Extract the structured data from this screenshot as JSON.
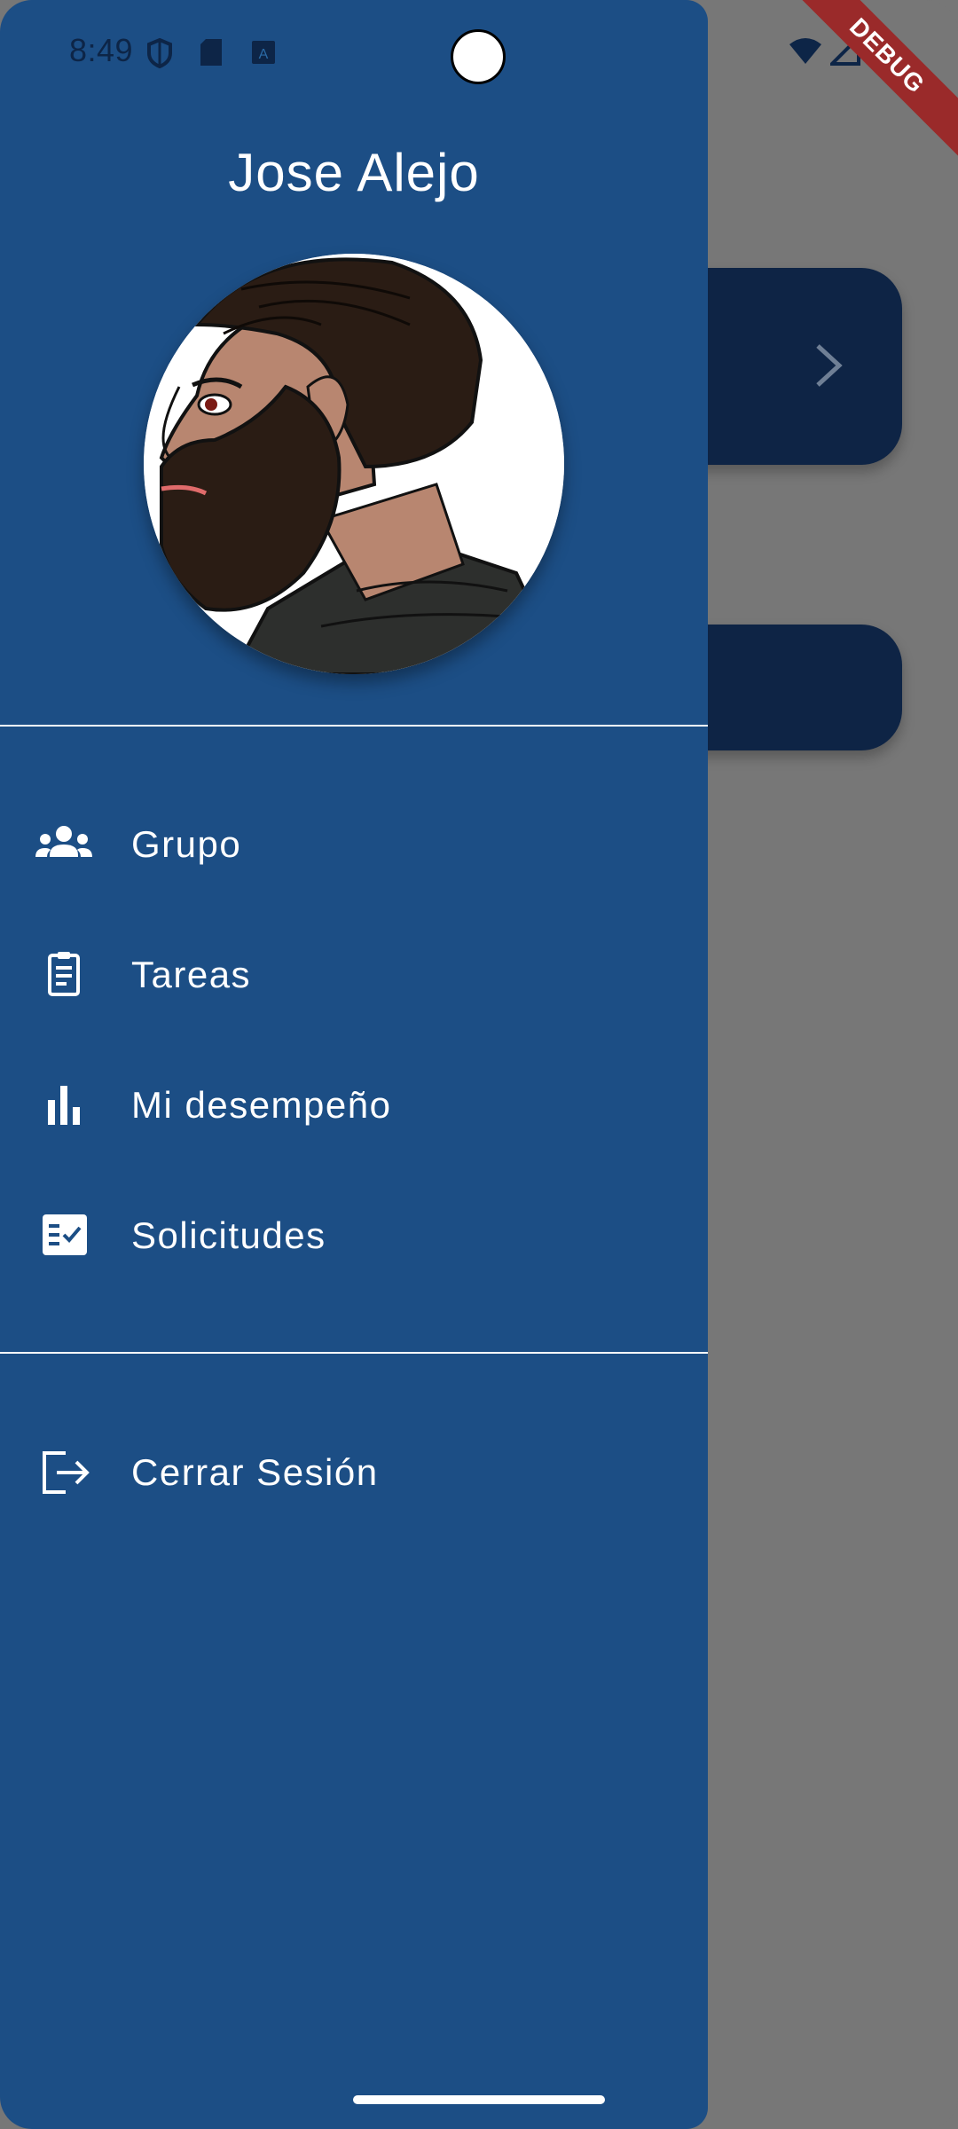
{
  "status_bar": {
    "time": "8:49"
  },
  "drawer": {
    "user_name": "Jose Alejo",
    "menu_items": [
      {
        "label": "Grupo",
        "icon": "group-icon"
      },
      {
        "label": "Tareas",
        "icon": "clipboard-icon"
      },
      {
        "label": "Mi desempeño",
        "icon": "bar-chart-icon"
      },
      {
        "label": "Solicitudes",
        "icon": "checklist-icon"
      }
    ],
    "logout": {
      "label": "Cerrar Sesión",
      "icon": "logout-icon"
    }
  },
  "debug_banner": "DEBUG",
  "colors": {
    "drawer_background": "#1c4e85",
    "scrim": "#777777",
    "card_background": "#0e2445",
    "text": "#ffffff"
  }
}
